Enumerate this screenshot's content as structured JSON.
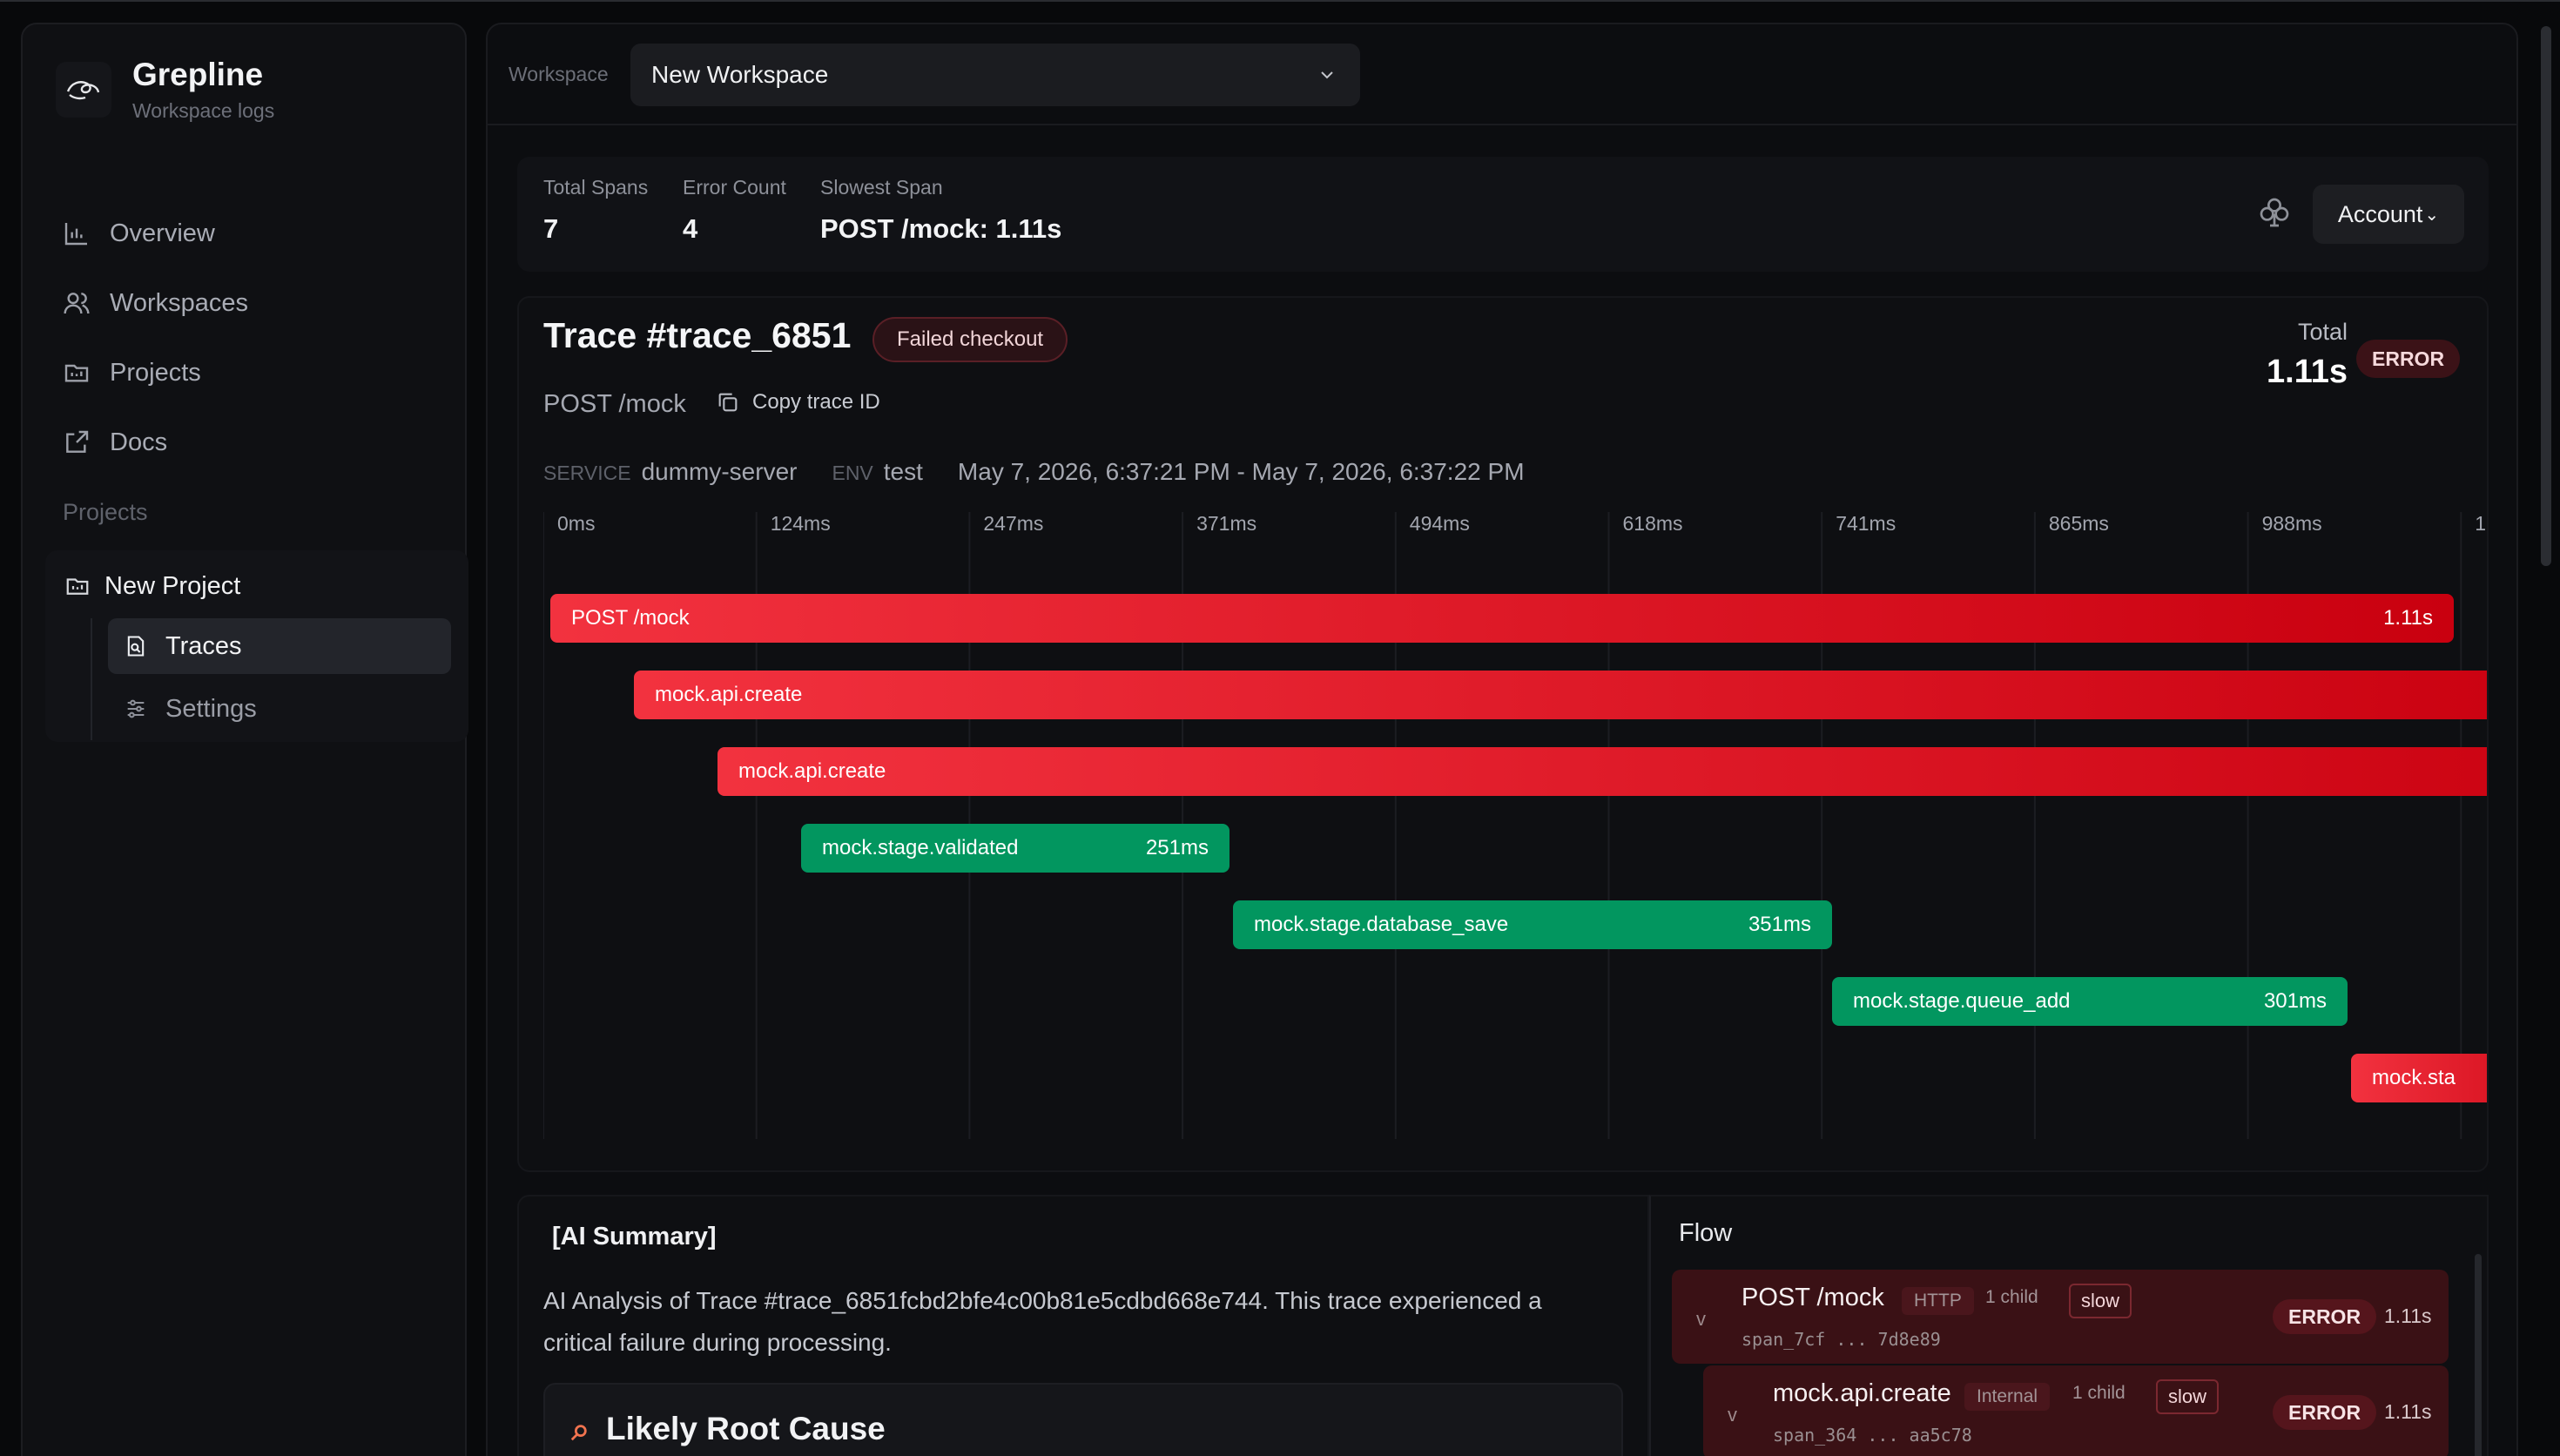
{
  "app": {
    "name": "Grepline",
    "subtitle": "Workspace logs"
  },
  "sidebar": {
    "nav": [
      {
        "label": "Overview",
        "icon": "bar-chart-icon"
      },
      {
        "label": "Workspaces",
        "icon": "users-icon"
      },
      {
        "label": "Projects",
        "icon": "folder-icon"
      },
      {
        "label": "Docs",
        "icon": "external-link-icon"
      }
    ],
    "section_label": "Projects",
    "project": {
      "name": "New Project",
      "items": [
        {
          "label": "Traces",
          "icon": "file-search-icon",
          "active": true
        },
        {
          "label": "Settings",
          "icon": "sliders-icon",
          "active": false
        }
      ]
    }
  },
  "workspace": {
    "label": "Workspace",
    "selected": "New Workspace"
  },
  "stats": {
    "total_spans_label": "Total Spans",
    "total_spans": "7",
    "error_count_label": "Error Count",
    "error_count": "4",
    "slowest_label": "Slowest Span",
    "slowest": "POST /mock: 1.11s",
    "account_label": "Account"
  },
  "trace": {
    "title": "Trace #trace_6851",
    "badge": "Failed checkout",
    "total_label": "Total",
    "total_value": "1.11s",
    "status": "ERROR",
    "route": "POST /mock",
    "copy_label": "Copy trace ID",
    "service_key": "SERVICE",
    "service": "dummy-server",
    "env_key": "ENV",
    "env": "test",
    "time_range": "May 7, 2026, 6:37:21 PM - May 7, 2026, 6:37:22 PM"
  },
  "timeline": {
    "ticks": [
      "0ms",
      "124ms",
      "247ms",
      "371ms",
      "494ms",
      "618ms",
      "741ms",
      "865ms",
      "988ms",
      "1."
    ],
    "spans": [
      {
        "name": "POST /mock",
        "duration": "1.11s",
        "status": "error"
      },
      {
        "name": "mock.api.create",
        "duration": "",
        "status": "error"
      },
      {
        "name": "mock.api.create",
        "duration": "",
        "status": "error"
      },
      {
        "name": "mock.stage.validated",
        "duration": "251ms",
        "status": "ok"
      },
      {
        "name": "mock.stage.database_save",
        "duration": "351ms",
        "status": "ok"
      },
      {
        "name": "mock.stage.queue_add",
        "duration": "301ms",
        "status": "ok"
      },
      {
        "name": "mock.sta",
        "duration": "",
        "status": "error"
      }
    ]
  },
  "ai_summary": {
    "heading": "[AI Summary]",
    "text": "AI Analysis of Trace #trace_6851fcbd2bfe4c00b81e5cdbd668e744. This trace experienced a critical failure during processing.",
    "root_cause_title": "Likely Root Cause"
  },
  "flow": {
    "heading": "Flow",
    "rows": [
      {
        "chevron": "v",
        "name": "POST /mock",
        "kind": "HTTP",
        "children": "1 child",
        "flag": "slow",
        "id": "span_7cf ... 7d8e89",
        "status": "ERROR",
        "duration": "1.11s"
      },
      {
        "chevron": "v",
        "name": "mock.api.create",
        "kind": "Internal",
        "children": "1 child",
        "flag": "slow",
        "id": "span_364 ... aa5c78",
        "status": "ERROR",
        "duration": "1.11s"
      }
    ]
  },
  "colors": {
    "error": "#e5202f",
    "ok": "#02965f",
    "background": "#08090b"
  }
}
